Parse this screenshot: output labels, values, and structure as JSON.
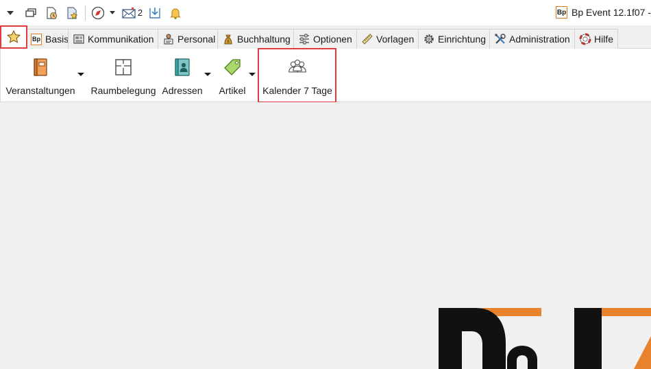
{
  "quick_access": {
    "mail_count": "2"
  },
  "app": {
    "logo_text": "Bp",
    "title": "Bp Event 12.1f07 -"
  },
  "tabs": [
    {
      "label": "Basis",
      "icon": "bp-logo-icon"
    },
    {
      "label": "Kommunikation",
      "icon": "kommunikation-icon"
    },
    {
      "label": "Personal",
      "icon": "personal-icon"
    },
    {
      "label": "Buchhaltung",
      "icon": "buchhaltung-icon"
    },
    {
      "label": "Optionen",
      "icon": "sliders-icon"
    },
    {
      "label": "Vorlagen",
      "icon": "ruler-icon"
    },
    {
      "label": "Einrichtung",
      "icon": "gear-icon"
    },
    {
      "label": "Administration",
      "icon": "tools-icon"
    },
    {
      "label": "Hilfe",
      "icon": "lifebuoy-icon"
    }
  ],
  "ribbon": {
    "buttons": [
      {
        "label": "Veranstaltungen",
        "icon": "book-icon"
      },
      {
        "label": "Raumbelegung",
        "icon": "floorplan-icon"
      },
      {
        "label": "Adressen",
        "icon": "contact-card-icon"
      },
      {
        "label": "Artikel",
        "icon": "tag-icon"
      },
      {
        "label": "Kalender 7 Tage",
        "icon": "people-group-icon"
      }
    ]
  },
  "colors": {
    "accent_orange": "#e07a1f",
    "highlight_red": "#e33c3c",
    "icon_teal": "#3aa6a6",
    "icon_green": "#8cc63f",
    "logo_black": "#111111"
  }
}
